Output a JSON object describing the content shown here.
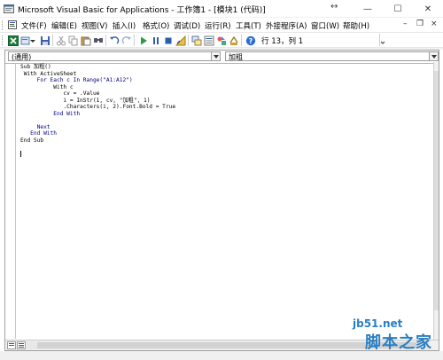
{
  "window": {
    "title": "Microsoft Visual Basic for Applications - 工作簿1 - [模块1 (代码)]",
    "restore_arrows": "↔",
    "min": "—",
    "max": "☐",
    "close": "✕"
  },
  "menu": {
    "items": [
      "文件(F)",
      "编辑(E)",
      "视图(V)",
      "插入(I)",
      "格式(O)",
      "调试(D)",
      "运行(R)",
      "工具(T)",
      "外接程序(A)",
      "窗口(W)",
      "帮助(H)"
    ],
    "mdi_min": "–",
    "mdi_max": "❐",
    "mdi_close": "×"
  },
  "toolbar": {
    "position": "行 13，列 1"
  },
  "editor": {
    "object_combo": "(通用)",
    "proc_combo": "加粗",
    "code_lines": [
      "Sub 加粗()",
      " With ActiveSheet",
      "     For Each c In Range(\"A1:A12\")",
      "          With c",
      "             cv = .Value",
      "             i = InStr(1, cv, \"加粗\", 1)",
      "             .Characters(i, 2).Font.Bold = True",
      "          End With",
      "",
      "     Next",
      "   End With",
      "End Sub",
      ""
    ]
  },
  "watermark": {
    "line1": "jb51.net",
    "line2": "脚本之家"
  },
  "colors": {
    "keyword": "#00007f",
    "watermark": "#2b7fc0"
  }
}
